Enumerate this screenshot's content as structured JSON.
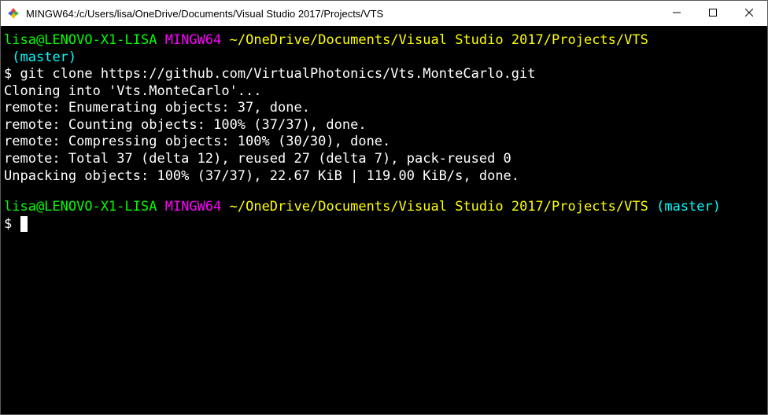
{
  "titlebar": {
    "title": "MINGW64:/c/Users/lisa/OneDrive/Documents/Visual Studio 2017/Projects/VTS"
  },
  "prompt1": {
    "user_host": "lisa@LENOVO-X1-LISA",
    "msys": "MINGW64",
    "path": "~/OneDrive/Documents/Visual Studio 2017/Projects/VTS",
    "branch_open": " (",
    "branch": "master",
    "branch_close": ")",
    "dollar": "$ ",
    "command": "git clone https://github.com/VirtualPhotonics/Vts.MonteCarlo.git"
  },
  "output": {
    "line1": "Cloning into 'Vts.MonteCarlo'...",
    "line2": "remote: Enumerating objects: 37, done.",
    "line3": "remote: Counting objects: 100% (37/37), done.",
    "line4": "remote: Compressing objects: 100% (30/30), done.",
    "line5": "remote: Total 37 (delta 12), reused 27 (delta 7), pack-reused 0",
    "line6": "Unpacking objects: 100% (37/37), 22.67 KiB | 119.00 KiB/s, done."
  },
  "prompt2": {
    "user_host": "lisa@LENOVO-X1-LISA",
    "msys": "MINGW64",
    "path": "~/OneDrive/Documents/Visual Studio 2017/Projects/VTS",
    "branch_open": "(",
    "branch": "master",
    "branch_close": ")",
    "dollar": "$ "
  }
}
